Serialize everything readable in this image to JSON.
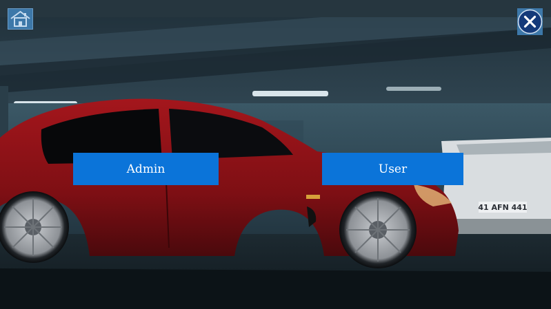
{
  "buttons": {
    "admin_label": "Admin",
    "user_label": "User"
  },
  "background": {
    "license_plate": "41 AFN 441"
  },
  "icons": {
    "home": "home-icon",
    "close": "close-icon"
  },
  "colors": {
    "button_blue": "#0b74d9",
    "icon_tile_blue": "#3d78a9",
    "car_red": "#8e1116",
    "garage_dark": "#14222c"
  }
}
